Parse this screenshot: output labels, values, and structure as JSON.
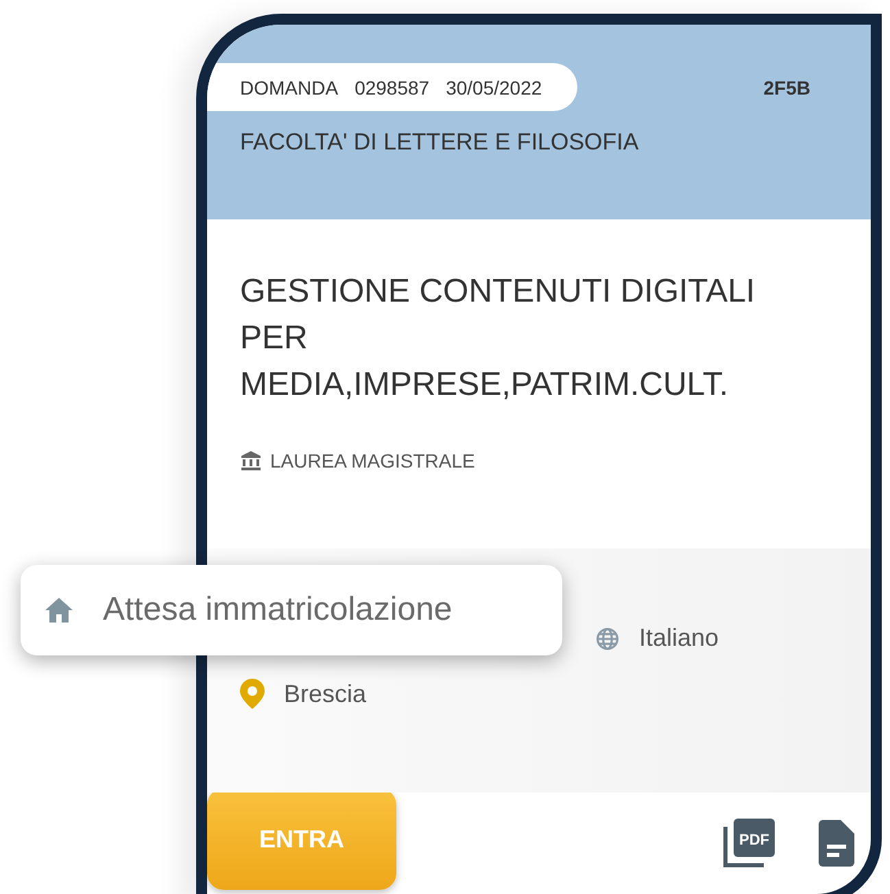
{
  "application": {
    "label": "DOMANDA",
    "number": "0298587",
    "date": "30/05/2022",
    "code": "2F5B",
    "faculty": "FACOLTA' DI LETTERE E FILOSOFIA"
  },
  "course": {
    "title": "GESTIONE CONTENUTI DIGITALI PER MEDIA,IMPRESE,PATRIM.CULT.",
    "degree": "LAUREA MAGISTRALE"
  },
  "status": "Attesa immatricolazione",
  "details": {
    "language": "Italiano",
    "location": "Brescia"
  },
  "enter_button": "ENTRA",
  "pdf_label": "PDF"
}
